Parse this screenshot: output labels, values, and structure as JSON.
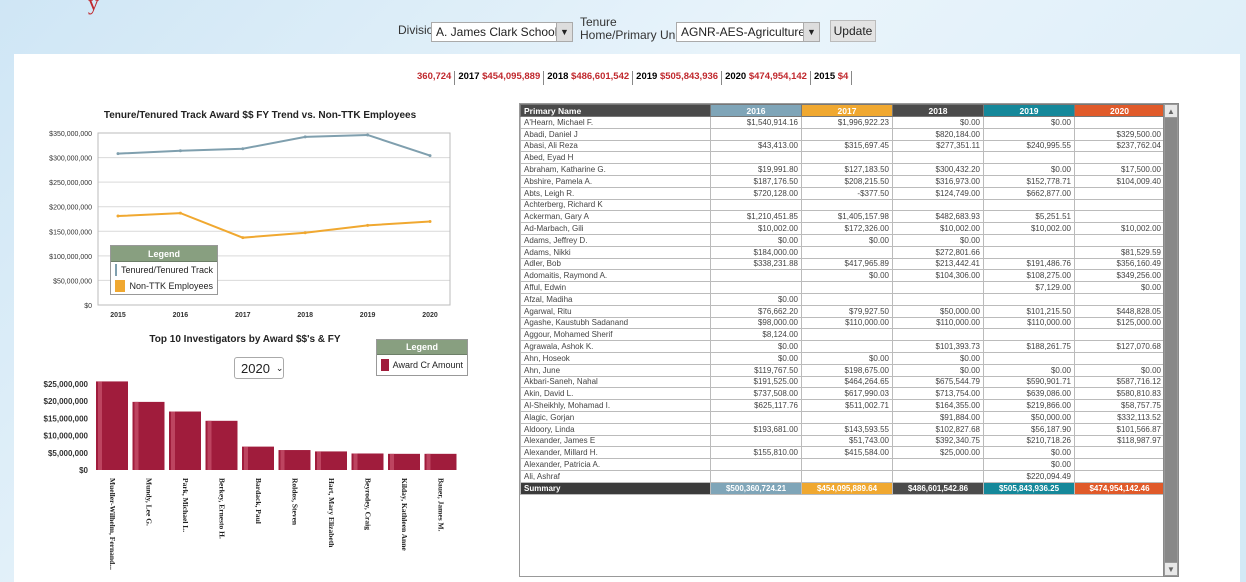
{
  "filters": {
    "division_label": "Division",
    "division_value": "A. James Clark School of",
    "tenure_label_1": "Tenure",
    "tenure_label_2": "Home/Primary Unit",
    "tenure_value": "AGNR-AES-Agriculture E",
    "update_label": "Update"
  },
  "ticker": [
    {
      "year": "",
      "value": "360,724"
    },
    {
      "year": "2017",
      "value": "$454,095,889"
    },
    {
      "year": "2018",
      "value": "$486,601,542"
    },
    {
      "year": "2019",
      "value": "$505,843,936"
    },
    {
      "year": "2020",
      "value": "$474,954,142"
    },
    {
      "year": "2015",
      "value": "$4"
    }
  ],
  "colors": {
    "tenured": "#7f9fae",
    "nonttk": "#f0a830",
    "bar": "#a01c3c",
    "col2016": "#7fa5b8",
    "col2017": "#f0a830",
    "col2018": "#4b4b4b",
    "col2019": "#15889a",
    "col2020": "#e05a2a"
  },
  "chart_data": [
    {
      "type": "line",
      "title": "Tenure/Tenured Track Award $$ FY Trend vs. Non-TTK Employees",
      "x": [
        "2015",
        "2016",
        "2017",
        "2018",
        "2019",
        "2020"
      ],
      "ylim": [
        0,
        350000000
      ],
      "yticks": [
        "$0",
        "$50,000,000",
        "$100,000,000",
        "$150,000,000",
        "$200,000,000",
        "$250,000,000",
        "$300,000,000",
        "$350,000,000"
      ],
      "series": [
        {
          "name": "Tenured/Tenured Track",
          "values": [
            308000000,
            314000000,
            318000000,
            342000000,
            346000000,
            304000000
          ]
        },
        {
          "name": "Non-TTK Employees",
          "values": [
            181000000,
            187000000,
            137000000,
            147000000,
            162000000,
            170000000
          ]
        }
      ],
      "legend_title": "Legend",
      "legend": "bottom-left"
    },
    {
      "type": "bar",
      "title": "Top 10 Investigators by Award $$'s & FY",
      "categories": [
        "Mueller-Wilhelm, Fernand...",
        "Mundy, Lee G.",
        "Park, Michael L.",
        "Berkey, Ernesto H.",
        "Bardack, Paul",
        "Roldos, Steven",
        "Hart, Mary Elizabeth",
        "Beyrodey, Craig",
        "Kilday, Kathleen Anne",
        "Bauer, James M."
      ],
      "values": [
        25800000,
        19800000,
        17000000,
        14300000,
        6800000,
        5800000,
        5400000,
        4800000,
        4700000,
        4700000
      ],
      "ylim": [
        0,
        25000000
      ],
      "yticks": [
        "$0",
        "$5,000,000",
        "$10,000,000",
        "$15,000,000",
        "$20,000,000",
        "$25,000,000"
      ],
      "series_name": "Award Cr Amount",
      "legend_title": "Legend",
      "selected_year": "2020"
    }
  ],
  "table": {
    "headers": [
      "Primary Name",
      "2016",
      "2017",
      "2018",
      "2019",
      "2020"
    ],
    "rows": [
      [
        "A'Hearn, Michael F.",
        "$1,540,914.16",
        "$1,996,922.23",
        "$0.00",
        "$0.00",
        ""
      ],
      [
        "Abadi, Daniel J",
        "",
        "",
        "$820,184.00",
        "",
        "$329,500.00"
      ],
      [
        "Abasi, Ali Reza",
        "$43,413.00",
        "$315,697.45",
        "$277,351.11",
        "$240,995.55",
        "$237,762.04"
      ],
      [
        "Abed, Eyad H",
        "",
        "",
        "",
        "",
        ""
      ],
      [
        "Abraham, Katharine G.",
        "$19,991.80",
        "$127,183.50",
        "$300,432.20",
        "$0.00",
        "$17,500.00"
      ],
      [
        "Abshire, Pamela A.",
        "$187,176.50",
        "$208,215.50",
        "$316,973.00",
        "$152,778.71",
        "$104,009.40"
      ],
      [
        "Abts, Leigh R.",
        "$720,128.00",
        "-$377.50",
        "$124,749.00",
        "$662,877.00",
        ""
      ],
      [
        "Achterberg, Richard K",
        "",
        "",
        "",
        "",
        ""
      ],
      [
        "Ackerman, Gary A",
        "$1,210,451.85",
        "$1,405,157.98",
        "$482,683.93",
        "$5,251.51",
        ""
      ],
      [
        "Ad-Marbach, Gili",
        "$10,002.00",
        "$172,326.00",
        "$10,002.00",
        "$10,002.00",
        "$10,002.00"
      ],
      [
        "Adams, Jeffrey D.",
        "$0.00",
        "$0.00",
        "$0.00",
        "",
        ""
      ],
      [
        "Adams, Nikki",
        "$184,000.00",
        "",
        "$272,801.66",
        "",
        "$81,529.59"
      ],
      [
        "Adler, Bob",
        "$338,231.88",
        "$417,965.89",
        "$213,442.41",
        "$191,486.76",
        "$356,160.49"
      ],
      [
        "Adomaitis, Raymond A.",
        "",
        "$0.00",
        "$104,306.00",
        "$108,275.00",
        "$349,256.00"
      ],
      [
        "Afful, Edwin",
        "",
        "",
        "",
        "$7,129.00",
        "$0.00"
      ],
      [
        "Afzal, Madiha",
        "$0.00",
        "",
        "",
        "",
        ""
      ],
      [
        "Agarwal, Ritu",
        "$76,662.20",
        "$79,927.50",
        "$50,000.00",
        "$101,215.50",
        "$448,828.05"
      ],
      [
        "Agashe, Kaustubh Sadanand",
        "$98,000.00",
        "$110,000.00",
        "$110,000.00",
        "$110,000.00",
        "$125,000.00"
      ],
      [
        "Aggour, Mohamed Sherif",
        "$8,124.00",
        "",
        "",
        "",
        ""
      ],
      [
        "Agrawala, Ashok K.",
        "$0.00",
        "",
        "$101,393.73",
        "$188,261.75",
        "$127,070.68"
      ],
      [
        "Ahn, Hoseok",
        "$0.00",
        "$0.00",
        "$0.00",
        "",
        ""
      ],
      [
        "Ahn, June",
        "$119,767.50",
        "$198,675.00",
        "$0.00",
        "$0.00",
        "$0.00"
      ],
      [
        "Akbari-Saneh, Nahal",
        "$191,525.00",
        "$464,264.65",
        "$675,544.79",
        "$590,901.71",
        "$587,716.12"
      ],
      [
        "Akin, David L.",
        "$737,508.00",
        "$617,990.03",
        "$713,754.00",
        "$639,086.00",
        "$580,810.83"
      ],
      [
        "Al-Sheikhly, Mohamad I.",
        "$625,117.76",
        "$511,002.71",
        "$164,355.00",
        "$219,866.00",
        "$58,757.75"
      ],
      [
        "Alagic, Gorjan",
        "",
        "",
        "$91,884.00",
        "$50,000.00",
        "$332,113.52"
      ],
      [
        "Aldoory, Linda",
        "$193,681.00",
        "$143,593.55",
        "$102,827.68",
        "$56,187.90",
        "$101,566.87"
      ],
      [
        "Alexander, James E",
        "",
        "$51,743.00",
        "$392,340.75",
        "$210,718.26",
        "$118,987.97"
      ],
      [
        "Alexander, Millard H.",
        "$155,810.00",
        "$415,584.00",
        "$25,000.00",
        "$0.00",
        ""
      ],
      [
        "Alexander, Patricia A.",
        "",
        "",
        "",
        "$0.00",
        ""
      ],
      [
        "Ali, Ashraf",
        "",
        "",
        "",
        "$220,094.49",
        ""
      ]
    ],
    "summary": [
      "Summary",
      "$500,360,724.21",
      "$454,095,889.64",
      "$486,601,542.86",
      "$505,843,936.25",
      "$474,954,142.46"
    ]
  }
}
